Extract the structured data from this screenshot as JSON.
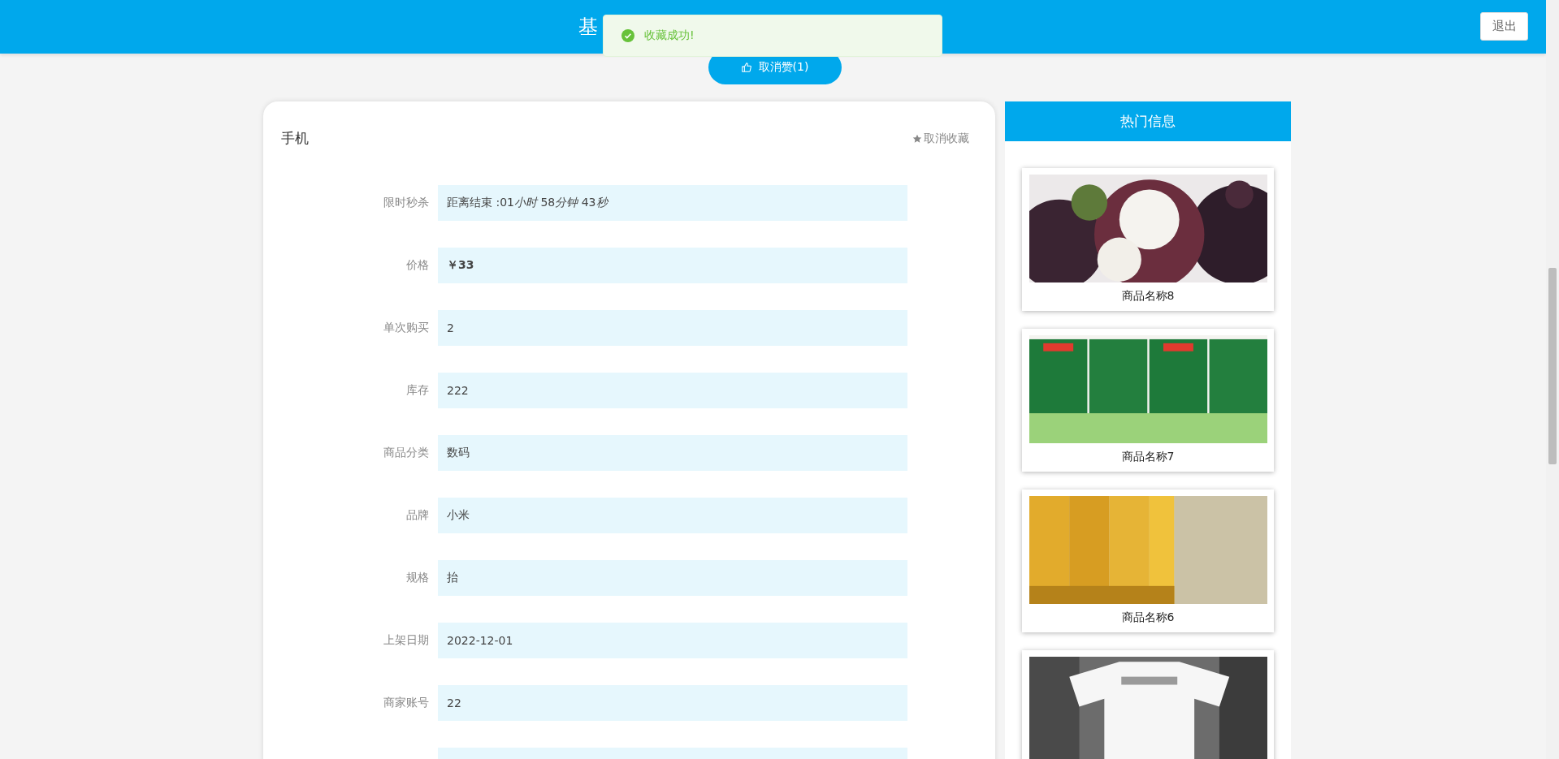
{
  "header": {
    "title": "基",
    "logout": "退出"
  },
  "toast": {
    "message": "收藏成功!"
  },
  "like_button": {
    "label": "取消赞(1)"
  },
  "product": {
    "name": "手机",
    "favorite_action": "取消收藏",
    "fields": [
      {
        "label": "限时秒杀",
        "kind": "countdown",
        "parts": [
          {
            "text": "距离结束 :01",
            "italic": false
          },
          {
            "text": "小时",
            "italic": true
          },
          {
            "text": " 58",
            "italic": false
          },
          {
            "text": "分钟",
            "italic": true
          },
          {
            "text": " 43",
            "italic": false
          },
          {
            "text": "秒",
            "italic": true
          }
        ]
      },
      {
        "label": "价格",
        "value": "￥33",
        "kind": "price"
      },
      {
        "label": "单次购买",
        "value": "2",
        "kind": "text"
      },
      {
        "label": "库存",
        "value": "222",
        "kind": "text"
      },
      {
        "label": "商品分类",
        "value": "数码",
        "kind": "text"
      },
      {
        "label": "品牌",
        "value": "小米",
        "kind": "text"
      },
      {
        "label": "规格",
        "value": "抬",
        "kind": "text"
      },
      {
        "label": "上架日期",
        "value": "2022-12-01",
        "kind": "text"
      },
      {
        "label": "商家账号",
        "value": "22",
        "kind": "text"
      }
    ]
  },
  "hot": {
    "title": "热门信息",
    "items": [
      {
        "name": "商品名称8",
        "kind": "picture"
      },
      {
        "name": "商品名称7",
        "kind": "picture"
      },
      {
        "name": "商品名称6",
        "kind": "picture"
      },
      {
        "kind": "picture"
      }
    ]
  }
}
